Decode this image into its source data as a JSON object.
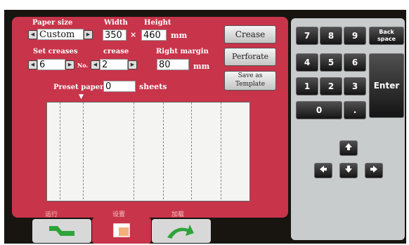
{
  "paper_size": {
    "label": "Paper size",
    "value": "Custom"
  },
  "width": {
    "label": "Width",
    "value": "350"
  },
  "height": {
    "label": "Height",
    "value": "460",
    "unit": "mm"
  },
  "times_symbol": "×",
  "set_creases": {
    "label": "Set creases",
    "value": "6",
    "no_label": "No."
  },
  "crease": {
    "label": "crease",
    "value": "2"
  },
  "right_margin": {
    "label": "Right margin",
    "value": "80",
    "unit": "mm"
  },
  "preset_paper": {
    "label": "Preset paper",
    "value": "0",
    "unit": "sheets"
  },
  "buttons": {
    "crease": "Crease",
    "perforate": "Perforate",
    "save_template_line1": "Save as",
    "save_template_line2": "Template"
  },
  "keypad": {
    "keys": [
      "7",
      "8",
      "9",
      "4",
      "5",
      "6",
      "1",
      "2",
      "3",
      "0",
      "."
    ],
    "backspace_line1": "Back",
    "backspace_line2": "space",
    "enter": "Enter"
  },
  "tabs": [
    {
      "label": "运行"
    },
    {
      "label": "设置"
    },
    {
      "label": "加载"
    }
  ],
  "colors": {
    "panel": "#c8344a",
    "keypad_panel": "#c9cccd",
    "key": "#1c1c1c"
  },
  "icons": {
    "up": "arrow-up",
    "down": "arrow-down",
    "left": "arrow-left",
    "right": "arrow-right"
  }
}
